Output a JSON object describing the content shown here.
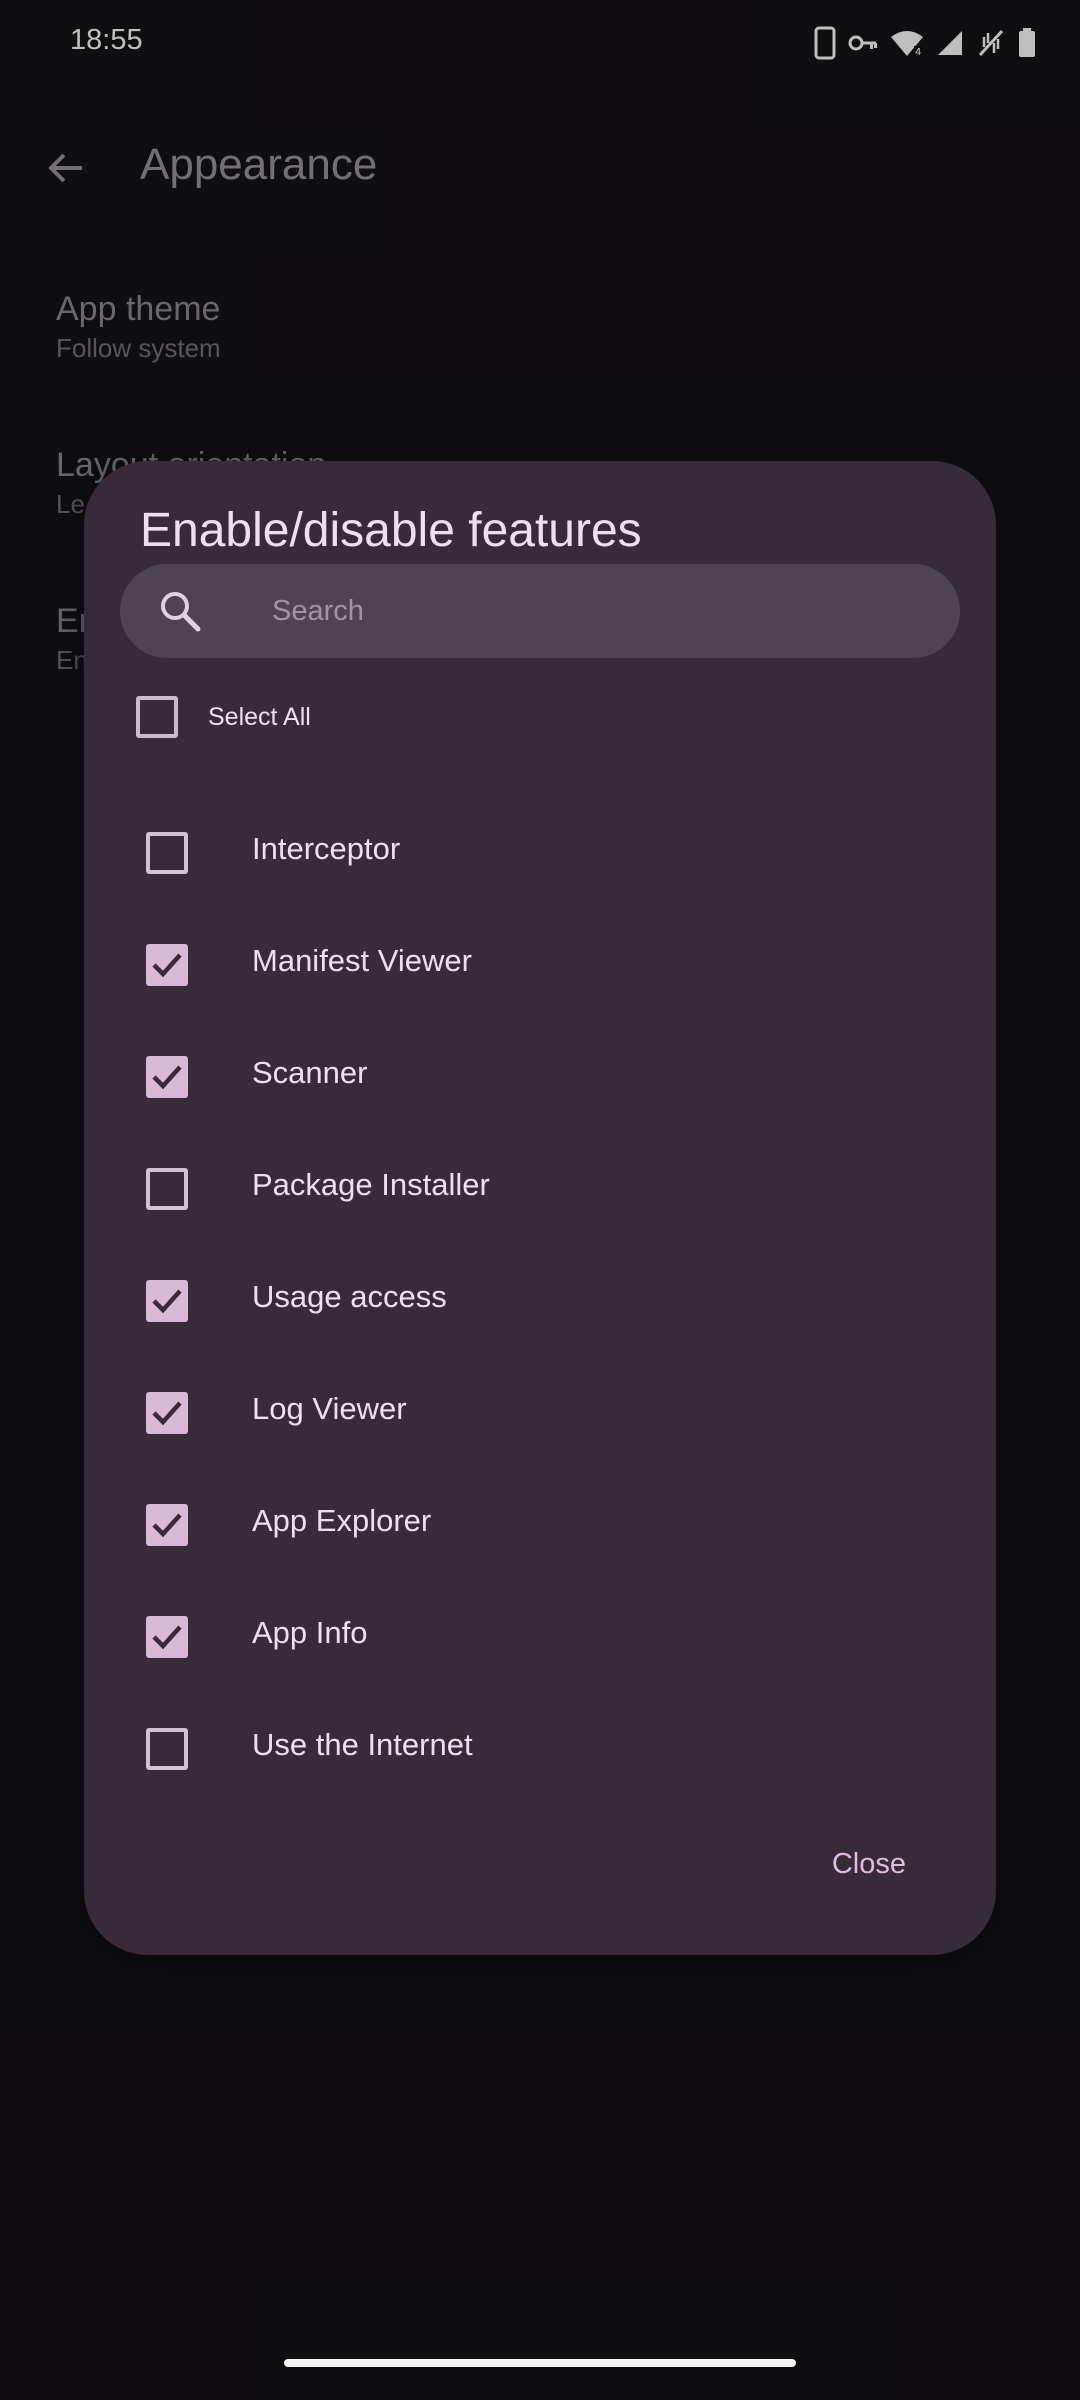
{
  "status_bar": {
    "time": "18:55",
    "icons": [
      "phone-icon",
      "vpn-key-icon",
      "wifi-icon",
      "signal-icon",
      "no-data-icon",
      "battery-icon"
    ]
  },
  "app_bar": {
    "title": "Appearance",
    "back_icon": "arrow-back-icon"
  },
  "preferences": [
    {
      "title": "App theme",
      "summary": "Follow system"
    },
    {
      "title": "Layout orientation",
      "summary": "Le"
    },
    {
      "title": "En",
      "summary": "En"
    }
  ],
  "dialog": {
    "title": "Enable/disable features",
    "search_placeholder": "Search",
    "search_value": "",
    "select_all_label": "Select All",
    "select_all_checked": false,
    "close_label": "Close",
    "features": [
      {
        "label": "Interceptor",
        "checked": false
      },
      {
        "label": "Manifest Viewer",
        "checked": true
      },
      {
        "label": "Scanner",
        "checked": true
      },
      {
        "label": "Package Installer",
        "checked": false
      },
      {
        "label": "Usage access",
        "checked": true
      },
      {
        "label": "Log Viewer",
        "checked": true
      },
      {
        "label": "App Explorer",
        "checked": true
      },
      {
        "label": "App Info",
        "checked": true
      },
      {
        "label": "Use the Internet",
        "checked": false
      }
    ]
  },
  "colors": {
    "background": "#151317",
    "dialog_surface": "#362b37",
    "search_surface": "#4e444f",
    "checkbox_fill": "#d8bad6",
    "accent_text": "#e3bbe0"
  }
}
